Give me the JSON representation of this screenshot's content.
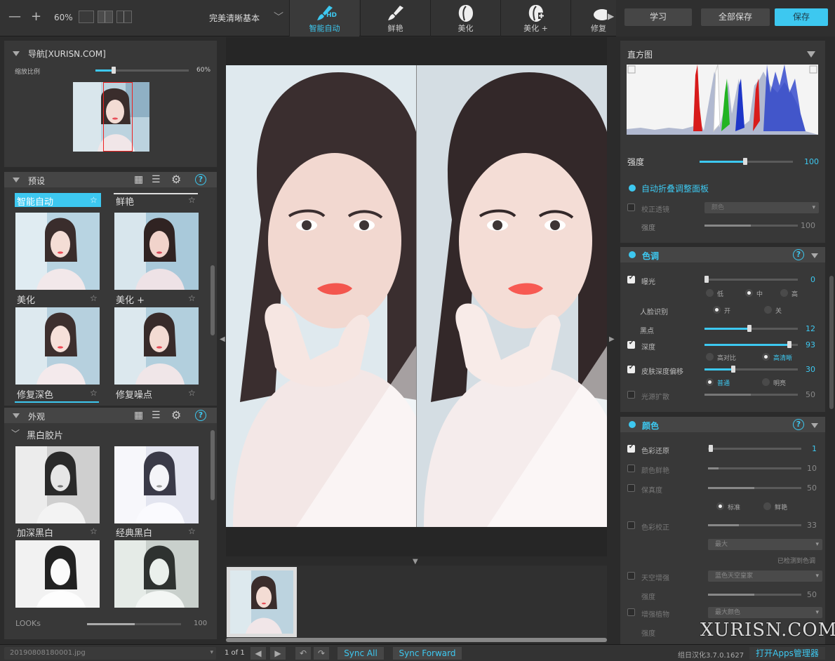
{
  "toolbar": {
    "zoom_out": "—",
    "zoom_in": "+",
    "zoom_level": "60%",
    "preset_name": "完美清晰基本",
    "tabs": [
      {
        "label": "智能自动",
        "badge": "HD",
        "active": true
      },
      {
        "label": "鲜艳",
        "active": false
      },
      {
        "label": "美化",
        "active": false
      },
      {
        "label": "美化 +",
        "active": false
      },
      {
        "label": "修复",
        "active": false
      }
    ],
    "learn": "学习",
    "save_all": "全部保存",
    "save": "保存"
  },
  "navigator": {
    "title": "导航[XURISN.COM]",
    "zoom_label": "缩放比例",
    "zoom_value": "60%",
    "zoom_fraction": 0.12
  },
  "presets": {
    "title": "预设",
    "items": [
      {
        "label": "智能自动",
        "selected": true
      },
      {
        "label": "鲜艳",
        "selected": false
      },
      {
        "label": "美化",
        "selected": false
      },
      {
        "label": "美化 +",
        "selected": false
      },
      {
        "label": "修复深色",
        "selected": false
      },
      {
        "label": "修复噪点",
        "selected": false
      }
    ]
  },
  "looks": {
    "title": "外观",
    "category": "黑白胶片",
    "items": [
      {
        "label": "加深黑白"
      },
      {
        "label": "经典黑白"
      }
    ],
    "strength_label": "LOOKs",
    "strength_value": "100"
  },
  "histogram": {
    "title": "直方图",
    "strength_label": "强度",
    "strength_value": "100",
    "strength_fraction": 0.48
  },
  "auto_fold": {
    "label": "自动折叠调整面板"
  },
  "lens": {
    "row1_label": "校正透镜",
    "row1_option": "颜色",
    "row2_label": "强度",
    "row2_value": "100"
  },
  "tone": {
    "title": "色调",
    "exposure_label": "曝光",
    "exposure_value": "0",
    "exposure_options": [
      "低",
      "中",
      "高"
    ],
    "exposure_selected": 1,
    "face_label": "人脸识别",
    "face_options": [
      "开",
      "关"
    ],
    "face_selected": 0,
    "black_label": "黑点",
    "black_value": "12",
    "depth_label": "深度",
    "depth_value": "93",
    "depth_options": [
      "高对比",
      "高清晰"
    ],
    "depth_selected": 1,
    "skin_label": "皮肤深度偏移",
    "skin_value": "30",
    "skin_options": [
      "普通",
      "明亮"
    ],
    "skin_selected": 0,
    "light_label": "光源扩散",
    "light_value": "50"
  },
  "color": {
    "title": "颜色",
    "restore_label": "色彩还原",
    "restore_value": "1",
    "vivid_label": "颜色鲜艳",
    "vivid_value": "10",
    "vivid_fraction": 0.1,
    "fidelity_label": "保真度",
    "fidelity_value": "50",
    "fidelity_options": [
      "标准",
      "鲜艳"
    ],
    "fidelity_selected": 0,
    "correct_label": "色彩校正",
    "correct_value": "33",
    "correct_fraction": 0.33,
    "correct_option": "最大",
    "detected_text": "已检测到色调",
    "sky_label": "天空增强",
    "sky_option": "蓝色天空皇家",
    "sky_strength_label": "强度",
    "sky_strength_value": "50",
    "foliage_label": "增强植物",
    "foliage_option": "最大颜色",
    "foliage_strength_label": "强度"
  },
  "status": {
    "filename": "20190808180001.jpg",
    "page": "1 of 1",
    "sync_all": "Sync All",
    "sync_forward": "Sync Forward",
    "version": "组日汉化3.7.0.1627",
    "open_apps": "打开Apps管理器",
    "watermark": "XURISN.COM"
  },
  "colors": {
    "accent": "#3dc8f0",
    "panel": "#383838",
    "background": "#2b2b2b"
  }
}
